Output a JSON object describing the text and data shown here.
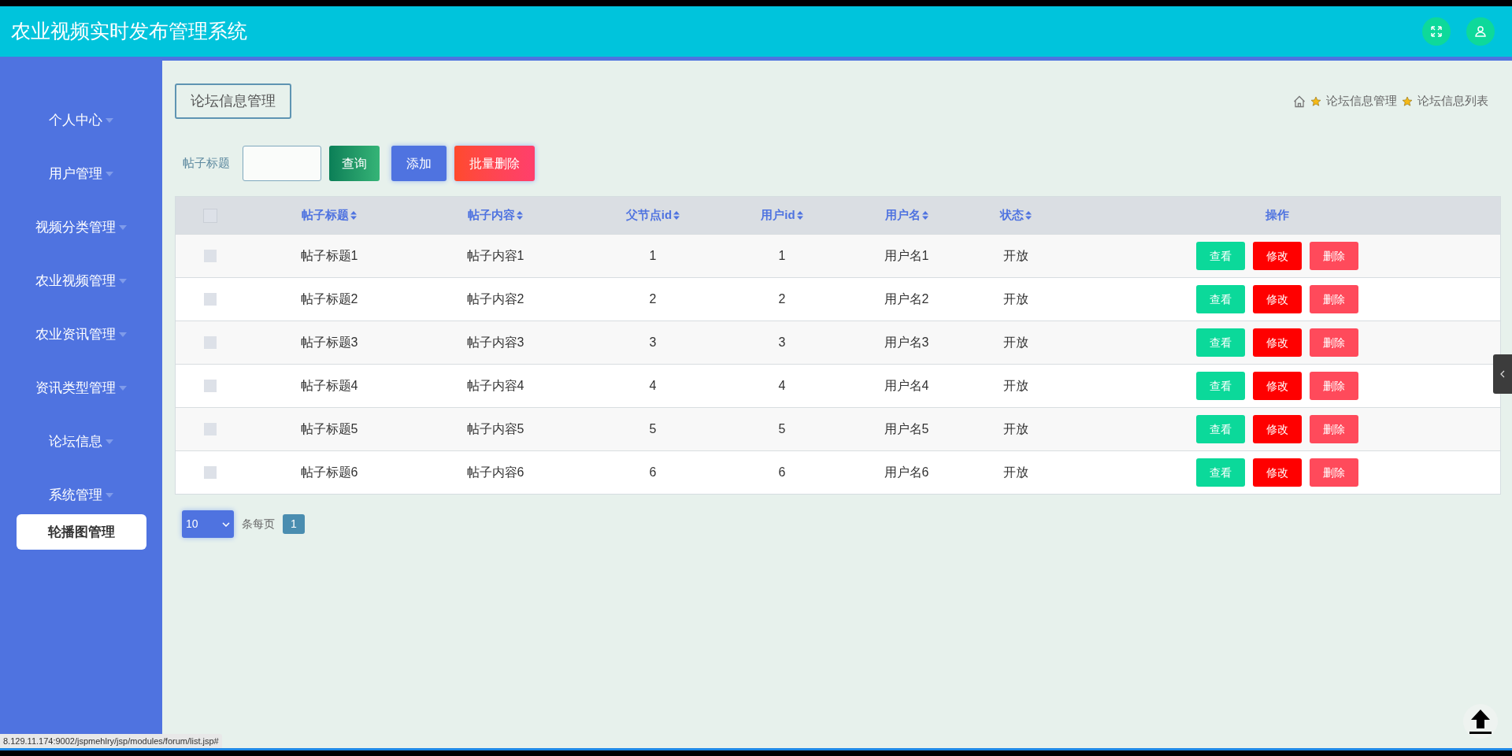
{
  "header": {
    "title": "农业视频实时发布管理系统"
  },
  "sidebar": {
    "items": [
      {
        "label": "个人中心"
      },
      {
        "label": "用户管理"
      },
      {
        "label": "视频分类管理"
      },
      {
        "label": "农业视频管理"
      },
      {
        "label": "农业资讯管理"
      },
      {
        "label": "资讯类型管理"
      },
      {
        "label": "论坛信息"
      },
      {
        "label": "系统管理",
        "children": [
          {
            "label": "轮播图管理"
          }
        ]
      }
    ]
  },
  "page_title": "论坛信息管理",
  "breadcrumb": [
    "论坛信息管理",
    "论坛信息列表"
  ],
  "search": {
    "label": "帖子标题",
    "button": "查询"
  },
  "toolbar": [
    {
      "kind": "add",
      "label": "添加"
    },
    {
      "kind": "batch_delete",
      "label": "批量删除"
    }
  ],
  "table": {
    "select_all": {
      "checked": false
    },
    "columns": [
      {
        "label": "帖子标题",
        "sortable": true
      },
      {
        "label": "帖子内容",
        "sortable": true
      },
      {
        "label": "父节点id",
        "sortable": true
      },
      {
        "label": "用户id",
        "sortable": true
      },
      {
        "label": "用户名",
        "sortable": true
      },
      {
        "label": "状态",
        "sortable": true
      },
      {
        "label": "操作",
        "sortable": false
      }
    ],
    "rows": [
      {
        "checked": false,
        "cells": [
          "帖子标题1",
          "帖子内容1",
          "1",
          "1",
          "用户名1",
          "开放"
        ],
        "actions": [
          {
            "kind": "view",
            "label": "查看"
          },
          {
            "kind": "edit",
            "label": "修改"
          },
          {
            "kind": "delete",
            "label": "删除"
          }
        ]
      },
      {
        "checked": false,
        "cells": [
          "帖子标题2",
          "帖子内容2",
          "2",
          "2",
          "用户名2",
          "开放"
        ],
        "actions": [
          {
            "kind": "view",
            "label": "查看"
          },
          {
            "kind": "edit",
            "label": "修改"
          },
          {
            "kind": "delete",
            "label": "删除"
          }
        ]
      },
      {
        "checked": false,
        "cells": [
          "帖子标题3",
          "帖子内容3",
          "3",
          "3",
          "用户名3",
          "开放"
        ],
        "actions": [
          {
            "kind": "view",
            "label": "查看"
          },
          {
            "kind": "edit",
            "label": "修改"
          },
          {
            "kind": "delete",
            "label": "删除"
          }
        ]
      },
      {
        "checked": false,
        "cells": [
          "帖子标题4",
          "帖子内容4",
          "4",
          "4",
          "用户名4",
          "开放"
        ],
        "actions": [
          {
            "kind": "view",
            "label": "查看"
          },
          {
            "kind": "edit",
            "label": "修改"
          },
          {
            "kind": "delete",
            "label": "删除"
          }
        ]
      },
      {
        "checked": false,
        "cells": [
          "帖子标题5",
          "帖子内容5",
          "5",
          "5",
          "用户名5",
          "开放"
        ],
        "actions": [
          {
            "kind": "view",
            "label": "查看"
          },
          {
            "kind": "edit",
            "label": "修改"
          },
          {
            "kind": "delete",
            "label": "删除"
          }
        ]
      },
      {
        "checked": false,
        "cells": [
          "帖子标题6",
          "帖子内容6",
          "6",
          "6",
          "用户名6",
          "开放"
        ],
        "actions": [
          {
            "kind": "view",
            "label": "查看"
          },
          {
            "kind": "edit",
            "label": "修改"
          },
          {
            "kind": "delete",
            "label": "删除"
          }
        ]
      }
    ]
  },
  "pagination": {
    "page_size": "10",
    "per_page_label": "条每页",
    "pages": [
      {
        "label": "1",
        "selected": true
      }
    ]
  },
  "status_url": "8.129.11.174:9002/jspmehlry/jsp/modules/forum/list.jsp#"
}
